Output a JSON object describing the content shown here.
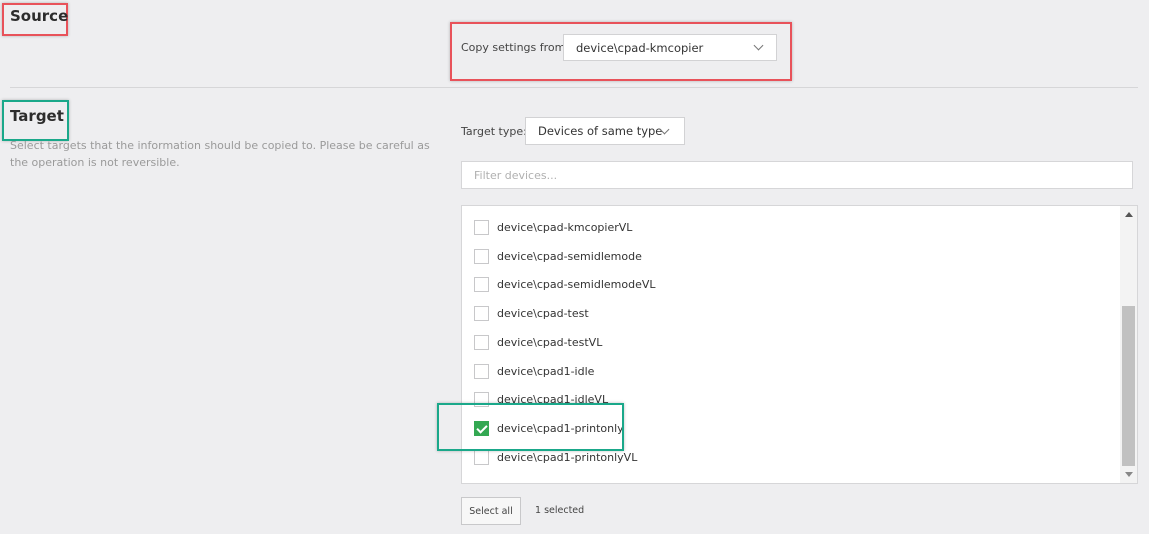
{
  "source": {
    "title": "Source",
    "copy_label": "Copy settings from:",
    "copy_value": "device\\cpad-kmcopier"
  },
  "target": {
    "title": "Target",
    "description": "Select targets that the information should be copied to. Please be careful as the operation is not reversible.",
    "type_label": "Target type:",
    "type_value": "Devices of same type",
    "filter_placeholder": "Filter devices...",
    "devices": [
      {
        "label": "device\\cpad-kmcopierVL",
        "checked": false
      },
      {
        "label": "device\\cpad-semidlemode",
        "checked": false
      },
      {
        "label": "device\\cpad-semidlemodeVL",
        "checked": false
      },
      {
        "label": "device\\cpad-test",
        "checked": false
      },
      {
        "label": "device\\cpad-testVL",
        "checked": false
      },
      {
        "label": "device\\cpad1-idle",
        "checked": false
      },
      {
        "label": "device\\cpad1-idleVL",
        "checked": false
      },
      {
        "label": "device\\cpad1-printonly",
        "checked": true
      },
      {
        "label": "device\\cpad1-printonlyVL",
        "checked": false
      }
    ],
    "select_all_label": "Select all",
    "selected_count": "1 selected"
  },
  "colors": {
    "highlight_red": "#e8525a",
    "highlight_green": "#1aa88a",
    "checkbox_checked": "#33a852"
  }
}
